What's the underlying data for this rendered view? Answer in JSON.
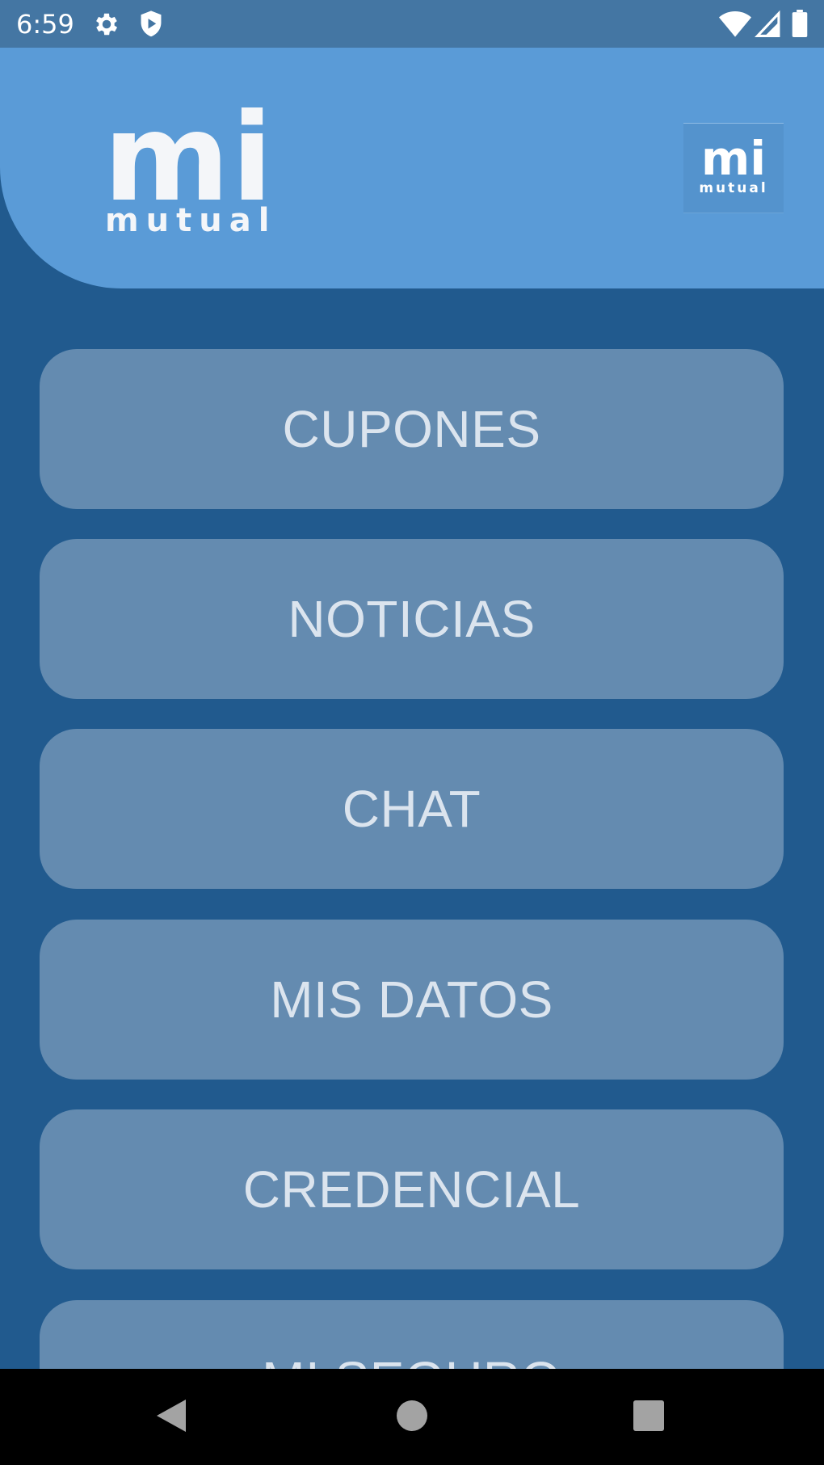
{
  "status_bar": {
    "time": "6:59",
    "icons": [
      "gear-icon",
      "shield-play-icon",
      "wifi-icon",
      "signal-icon",
      "battery-icon"
    ]
  },
  "header": {
    "logo_main": {
      "mi": "mi",
      "mutual": "mutual"
    },
    "logo_small": {
      "mi": "mi",
      "mutual": "mutual"
    },
    "background_color": "#5a9bd7"
  },
  "menu": {
    "items": [
      {
        "label": "CUPONES"
      },
      {
        "label": "NOTICIAS"
      },
      {
        "label": "CHAT"
      },
      {
        "label": "MIS DATOS"
      },
      {
        "label": "CREDENCIAL"
      },
      {
        "label": "MI SEGURO"
      }
    ],
    "button_color": "#648bb0",
    "text_color": "#dbe4ee",
    "background_color": "#215a8e"
  },
  "nav_bar": {
    "buttons": [
      "back-icon",
      "home-icon",
      "recents-icon"
    ]
  }
}
